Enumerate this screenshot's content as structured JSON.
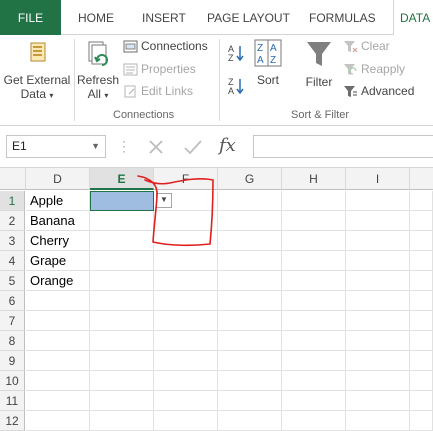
{
  "ribbon_tabs": [
    "FILE",
    "HOME",
    "INSERT",
    "PAGE LAYOUT",
    "FORMULAS",
    "DATA"
  ],
  "ribbon": {
    "get_external_data": [
      "Get External",
      "Data"
    ],
    "refresh_all": [
      "Refresh",
      "All"
    ],
    "connections": "Connections",
    "properties": "Properties",
    "edit_links": "Edit Links",
    "connections_group": "Connections",
    "sort": "Sort",
    "filter": "Filter",
    "clear": "Clear",
    "reapply": "Reapply",
    "advanced": "Advanced",
    "sort_filter_group": "Sort & Filter"
  },
  "formula_bar": {
    "name_box": "E1",
    "value": ""
  },
  "sheet": {
    "columns": [
      "D",
      "E",
      "F",
      "G",
      "H",
      "I"
    ],
    "rows": [
      "1",
      "2",
      "3",
      "4",
      "5",
      "6",
      "7",
      "8",
      "9",
      "10",
      "11",
      "12"
    ],
    "column_d_values": [
      "Apple",
      "Banana",
      "Cherry",
      "Grape",
      "Orange",
      "",
      "",
      "",
      "",
      "",
      "",
      ""
    ],
    "active_cell": "E1"
  },
  "colors": {
    "accent": "#217346",
    "selected_cell_fill": "#9fbde0",
    "annotation_stroke": "#e02020"
  },
  "icons": [
    "get-external-data-icon",
    "refresh-all-icon",
    "connections-icon",
    "properties-icon",
    "edit-links-icon",
    "sort-az-icon",
    "sort-za-icon",
    "sort-icon",
    "filter-icon",
    "clear-icon",
    "reapply-icon",
    "advanced-icon",
    "cancel-icon",
    "enter-icon",
    "fx-icon",
    "dropdown-arrow-icon"
  ]
}
